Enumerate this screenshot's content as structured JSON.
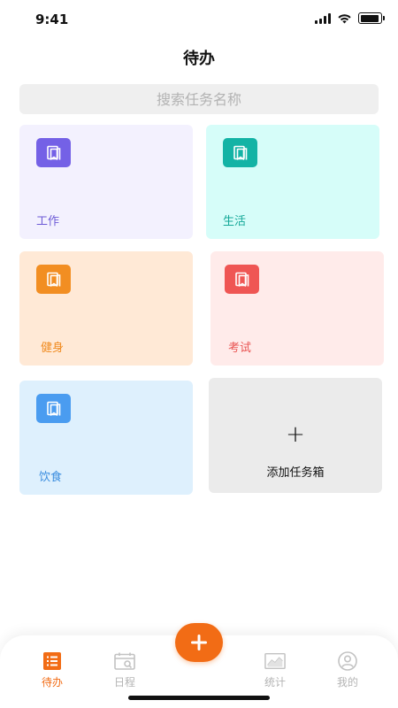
{
  "status_bar": {
    "time": "9:41",
    "battery_level": 0.95
  },
  "header": {
    "title": "待办"
  },
  "search": {
    "placeholder": "搜索任务名称"
  },
  "task_boxes": [
    {
      "label": "工作",
      "icon": "bookmark-icon",
      "color": "#7461e6"
    },
    {
      "label": "生活",
      "icon": "bookmark-icon",
      "color": "#13b3a5"
    },
    {
      "label": "健身",
      "icon": "bookmark-icon",
      "color": "#f28e22"
    },
    {
      "label": "考试",
      "icon": "bookmark-icon",
      "color": "#ef5654"
    },
    {
      "label": "饮食",
      "icon": "bookmark-icon",
      "color": "#4a9cf0"
    }
  ],
  "add_box": {
    "symbol": "+",
    "label": "添加任务箱"
  },
  "tab_bar": {
    "accent": "#f26c15",
    "items": [
      {
        "label": "待办",
        "icon": "list-icon",
        "active": true
      },
      {
        "label": "日程",
        "icon": "calendar-icon",
        "active": false
      },
      {
        "label": "统计",
        "icon": "chart-icon",
        "active": false
      },
      {
        "label": "我的",
        "icon": "profile-icon",
        "active": false
      }
    ],
    "fab_icon": "plus-icon"
  }
}
